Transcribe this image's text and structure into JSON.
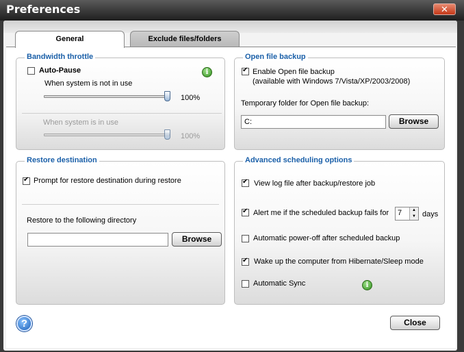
{
  "window": {
    "title": "Preferences",
    "close_glyph": "✕"
  },
  "tabs": [
    {
      "label": "General",
      "active": true
    },
    {
      "label": "Exclude files/folders",
      "active": false
    }
  ],
  "bandwidth": {
    "legend": "Bandwidth throttle",
    "auto_pause_label": "Auto-Pause",
    "auto_pause_checked": false,
    "not_in_use_label": "When system is not in use",
    "not_in_use_value": "100%",
    "not_in_use_level": 1.0,
    "in_use_label": "When system is in use",
    "in_use_value": "100%",
    "in_use_level": 1.0,
    "info_icon": "info-icon"
  },
  "open_file_backup": {
    "legend": "Open file backup",
    "enable_label": "Enable Open file backup",
    "enable_checked": true,
    "availability_note": "(available with Windows 7/Vista/XP/2003/2008)",
    "temp_folder_label": "Temporary folder for Open file backup:",
    "temp_folder_value": "C:",
    "browse_label": "Browse"
  },
  "restore": {
    "legend": "Restore destination",
    "prompt_label": "Prompt for restore destination during restore",
    "prompt_checked": true,
    "directory_label": "Restore to the following directory",
    "directory_value": "",
    "browse_label": "Browse"
  },
  "scheduling": {
    "legend": "Advanced scheduling options",
    "view_log_label": "View log file after backup/restore job",
    "view_log_checked": true,
    "alert_label": "Alert me if the scheduled backup fails for",
    "alert_checked": true,
    "alert_days_value": "7",
    "alert_days_unit": "days",
    "power_off_label": "Automatic power-off after scheduled backup",
    "power_off_checked": false,
    "wake_label": "Wake up the computer from Hibernate/Sleep mode",
    "wake_checked": true,
    "auto_sync_label": "Automatic Sync",
    "auto_sync_checked": false
  },
  "footer": {
    "help_glyph": "?",
    "close_label": "Close"
  },
  "colors": {
    "legend": "#1a5fa8",
    "titlebar": "#2a2a2a",
    "close_button": "#c43818",
    "info_icon": "#2f8f1c",
    "help_icon": "#1a5fb8"
  }
}
